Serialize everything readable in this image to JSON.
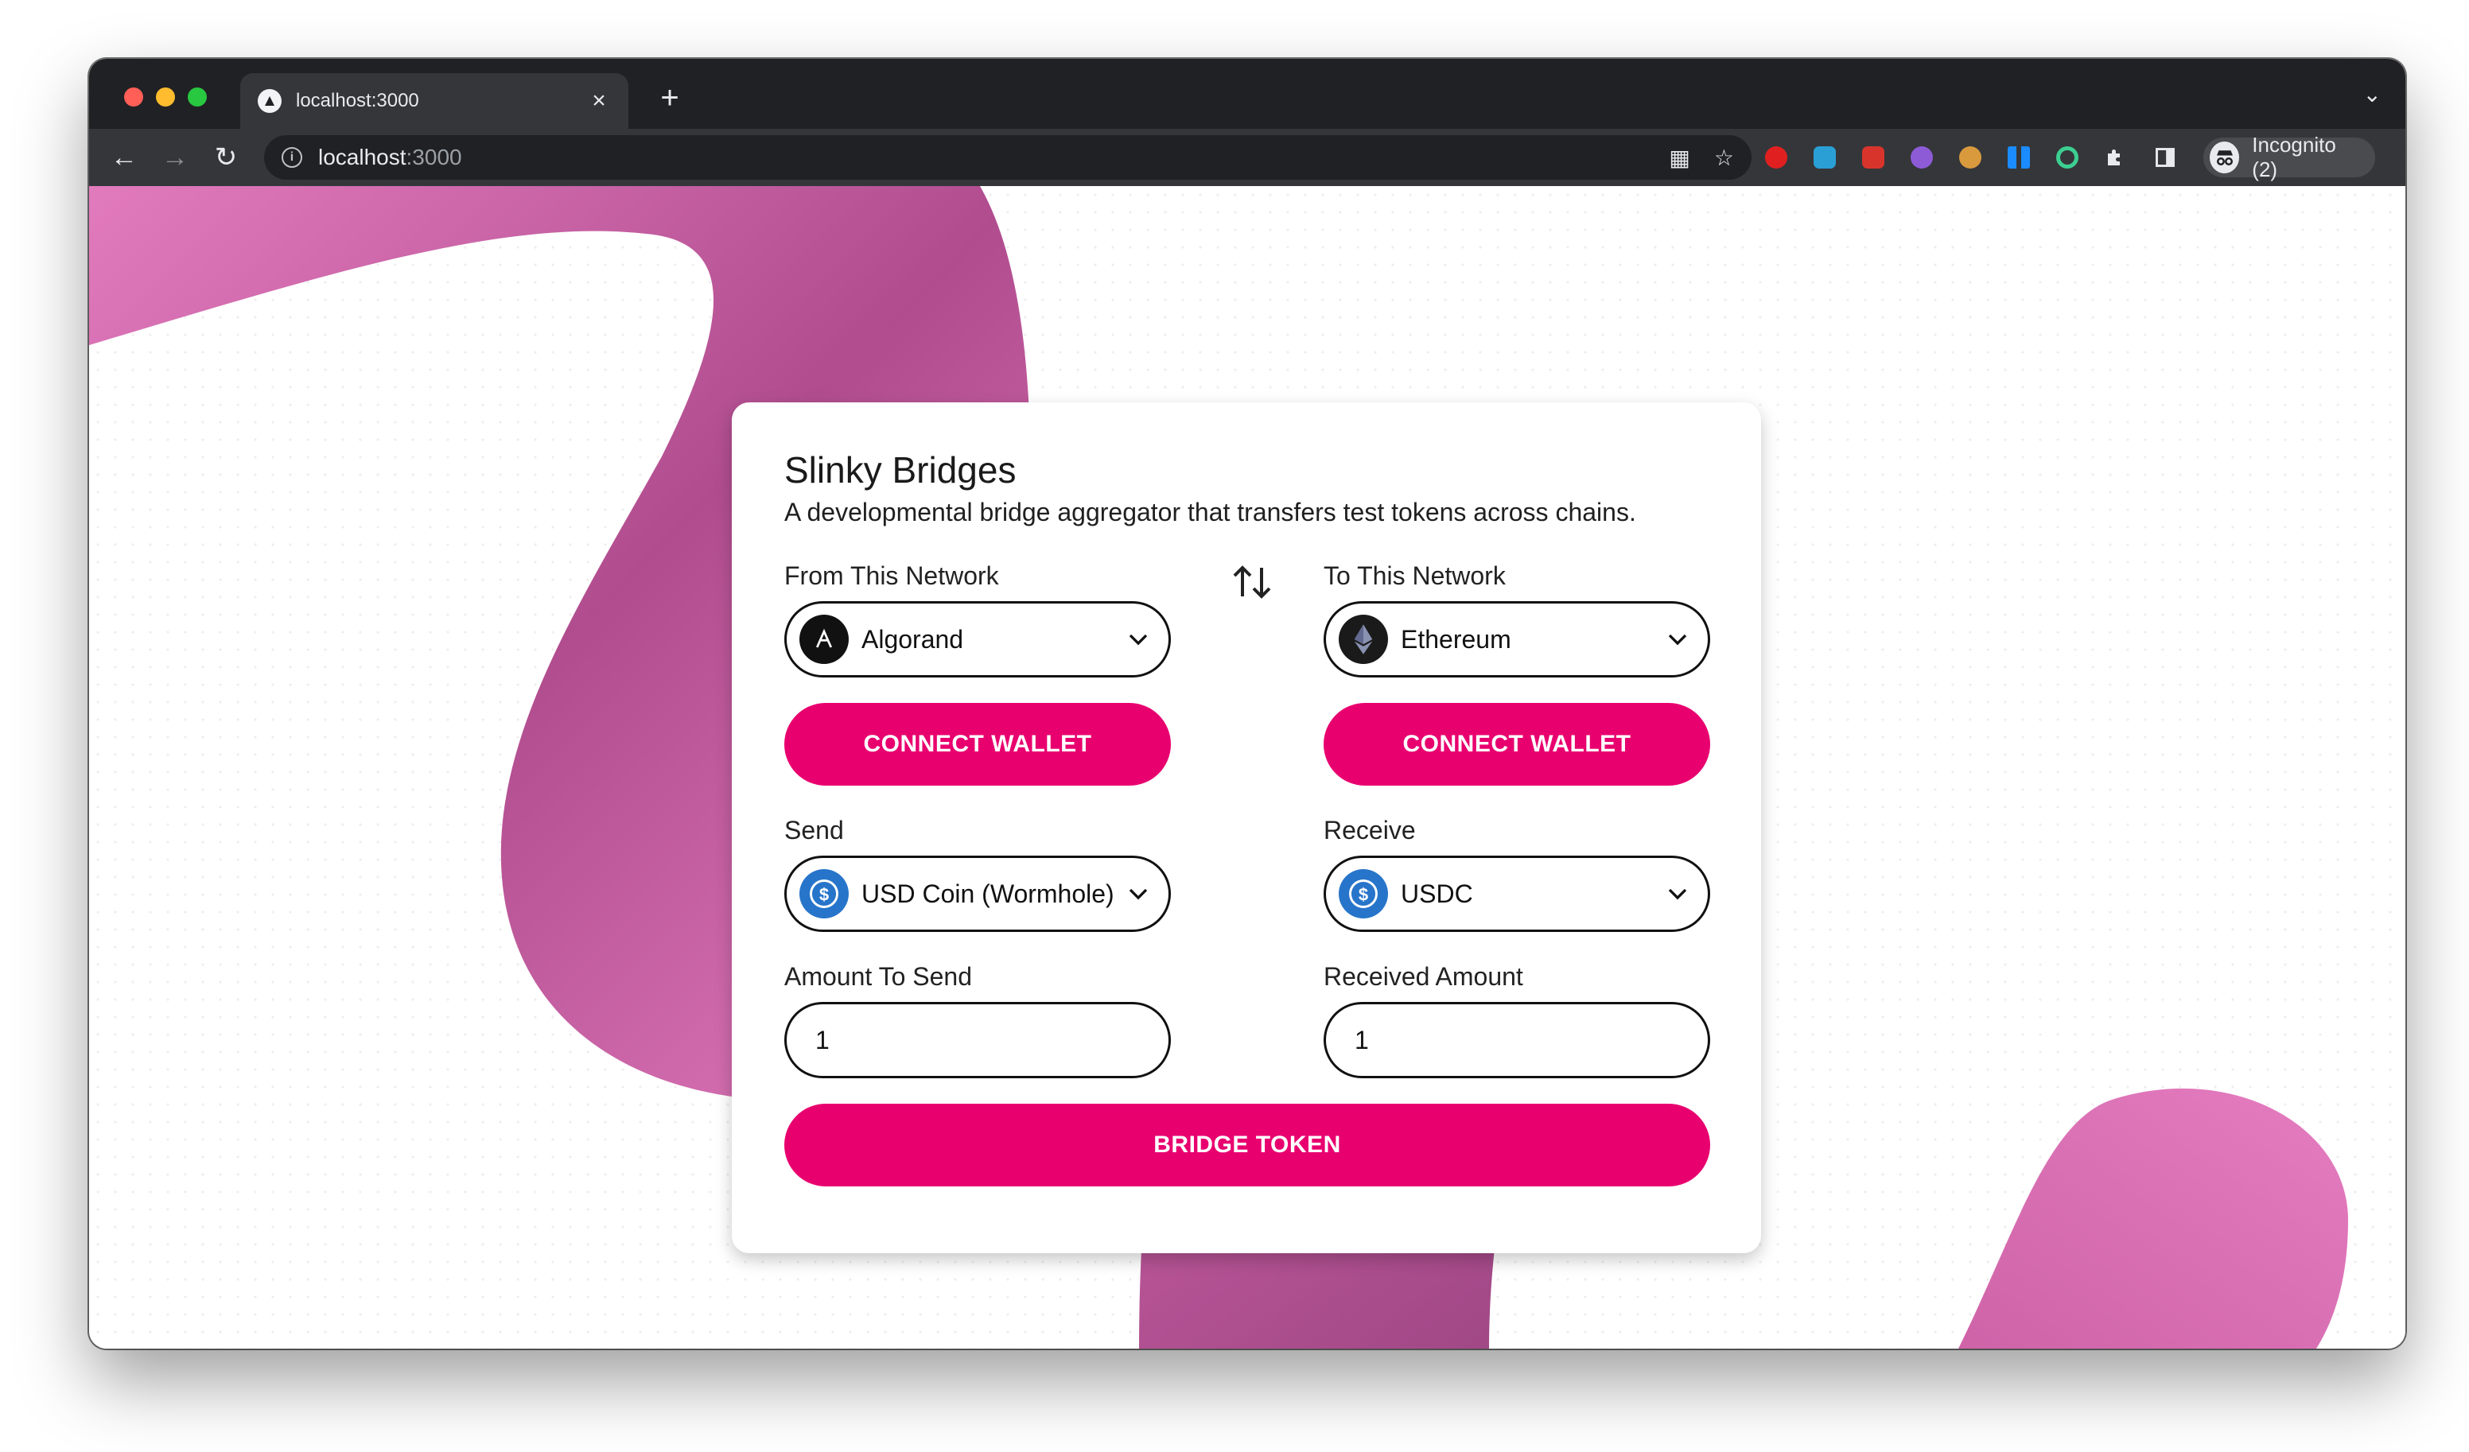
{
  "browser": {
    "tab_title": "localhost:3000",
    "url_host": "localhost",
    "url_port": ":3000",
    "profile_label": "Incognito (2)"
  },
  "app": {
    "title": "Slinky Bridges",
    "subtitle": "A developmental bridge aggregator that transfers test tokens across chains.",
    "from_label": "From This Network",
    "to_label": "To This Network",
    "from_network": "Algorand",
    "to_network": "Ethereum",
    "connect_label": "CONNECT WALLET",
    "send_label": "Send",
    "receive_label": "Receive",
    "send_token": "USD Coin (Wormhole)",
    "receive_token": "USDC",
    "amount_send_label": "Amount To Send",
    "amount_received_label": "Received Amount",
    "amount_send_value": "1",
    "amount_received_value": "1",
    "bridge_label": "BRIDGE TOKEN"
  },
  "colors": {
    "accent": "#e8006f",
    "blob": "#d45fa8",
    "usdc": "#2775ca"
  },
  "icons": [
    "swap-arrows-icon",
    "algorand-icon",
    "ethereum-icon",
    "usdc-icon",
    "chevron-down-icon"
  ]
}
